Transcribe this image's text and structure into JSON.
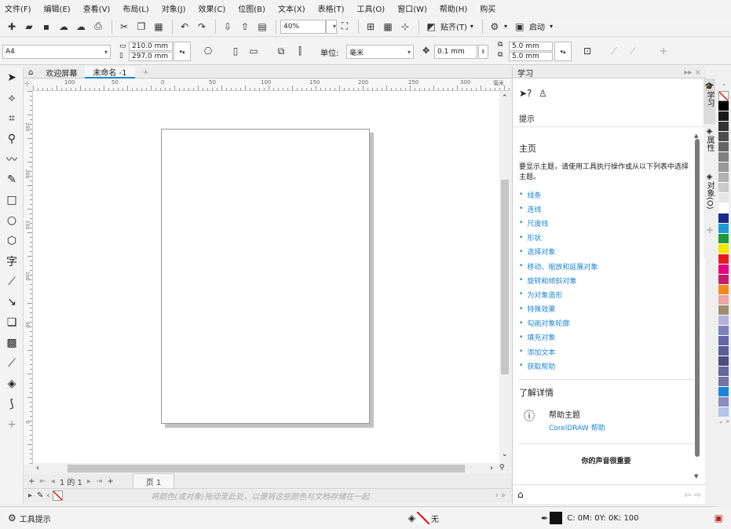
{
  "menu": [
    "文件(F)",
    "编辑(E)",
    "查看(V)",
    "布局(L)",
    "对象(J)",
    "效果(C)",
    "位图(B)",
    "文本(X)",
    "表格(T)",
    "工具(O)",
    "窗口(W)",
    "帮助(H)",
    "购买"
  ],
  "toolbar1": {
    "zoom": "40%",
    "snap_label": "贴齐(T)",
    "launch_label": "启动"
  },
  "toolbar2": {
    "page_size": "A4",
    "width": "210.0 mm",
    "height": "297.0 mm",
    "units_label": "单位:",
    "units_value": "毫米",
    "nudge": "0.1 mm",
    "dup_x": "5.0 mm",
    "dup_y": "5.0 mm"
  },
  "doc_tabs": {
    "welcome": "欢迎屏幕",
    "doc": "未命名 -1"
  },
  "ruler_h": [
    "100",
    "50",
    "0",
    "50",
    "100",
    "150",
    "200",
    "250",
    "300"
  ],
  "ruler_unit": "毫米",
  "ruler_v": [
    "250",
    "200",
    "150",
    "100",
    "50",
    "0"
  ],
  "page_nav": {
    "counter": "1 的 1",
    "page_tab": "页 1"
  },
  "color_hint": "将颜色(或对象)拖动至此处，以便将这些颜色与文档存储在一起",
  "status": {
    "tool_hint": "工具提示",
    "fill_label": "无",
    "outline_value": "C: 0M: 0Y: 0K: 100"
  },
  "docker": {
    "title": "学习",
    "hints_label": "提示",
    "home_title": "主页",
    "home_desc": "要显示主题，请使用工具执行操作或从以下列表中选择主题。",
    "links": [
      "线条",
      "连线",
      "尺度线",
      "形状",
      "选择对象",
      "移动、缩放和延展对象",
      "旋转和倾斜对象",
      "为对象造形",
      "特殊效果",
      "勾画对象轮廓",
      "填充对象",
      "添加文本",
      "获取帮助"
    ],
    "more_title": "了解详情",
    "help_topic": "帮助主题",
    "help_link": "CorelDRAW 帮助",
    "feedback": "你的声音很重要"
  },
  "side_tabs": {
    "learn": "学习",
    "properties": "属性",
    "objects": "对象(O)"
  },
  "palette": [
    "#000000",
    "#1a1a1a",
    "#333333",
    "#4d4d4d",
    "#666666",
    "#808080",
    "#999999",
    "#b3b3b3",
    "#cccccc",
    "#e6e6e6",
    "#ffffff",
    "#1c2a8c",
    "#1c9ad8",
    "#1a9b3c",
    "#f2e600",
    "#e6191e",
    "#e4007f",
    "#c21f6b",
    "#f08a1d",
    "#e8a6a6",
    "#9e8f74",
    "#b3b3d9",
    "#8080bf",
    "#6666a6",
    "#5c5c99",
    "#4d4d80",
    "#666699",
    "#7373a6",
    "#1a86d8",
    "#8c8cc0",
    "#b3c6e6"
  ],
  "colors": {
    "accent": "#1a86d8"
  }
}
